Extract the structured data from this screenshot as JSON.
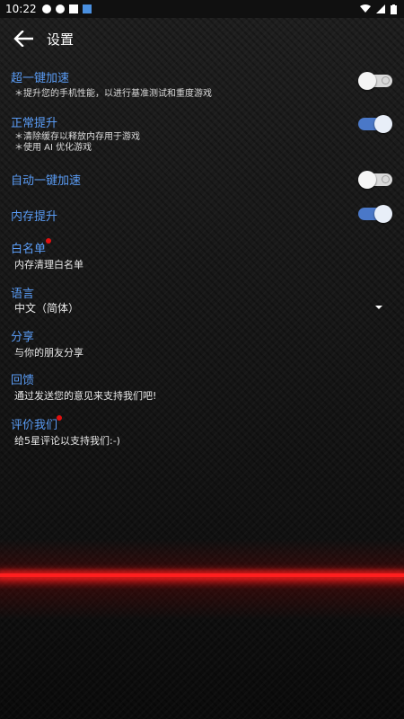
{
  "status_bar": {
    "time": "10:22"
  },
  "toolbar": {
    "title": "设置"
  },
  "settings": {
    "boost": {
      "title": "超一键加速",
      "desc": "＊提升您的手机性能，以进行基准测试和重度游戏",
      "toggle_on": false
    },
    "normal_boost": {
      "title": "正常提升",
      "desc_1": "＊清除缓存以释放内存用于游戏",
      "desc_2": "＊使用 AI 优化游戏",
      "toggle_on": true
    },
    "auto_boost": {
      "title": "自动一键加速",
      "toggle_on": false
    },
    "memory_boost": {
      "title": "内存提升",
      "toggle_on": true
    },
    "whitelist": {
      "title": "白名单",
      "subtitle": "内存清理白名单"
    },
    "language": {
      "title": "语言",
      "value": "中文（简体）"
    },
    "share": {
      "title": "分享",
      "subtitle": "与你的朋友分享"
    },
    "feedback": {
      "title": "回馈",
      "subtitle": "通过发送您的意见来支持我们吧!"
    },
    "rate": {
      "title": "评价我们",
      "subtitle": "给5星评论以支持我们:-)"
    }
  },
  "colors": {
    "accent": "#5a9cf5",
    "toggle_on": "#4a78c8",
    "notification_dot": "#e01010",
    "laser": "#ff1e1e"
  },
  "icons": [
    "back-arrow-icon",
    "dropdown-arrow-icon",
    "wifi-icon",
    "signal-icon",
    "battery-icon"
  ]
}
